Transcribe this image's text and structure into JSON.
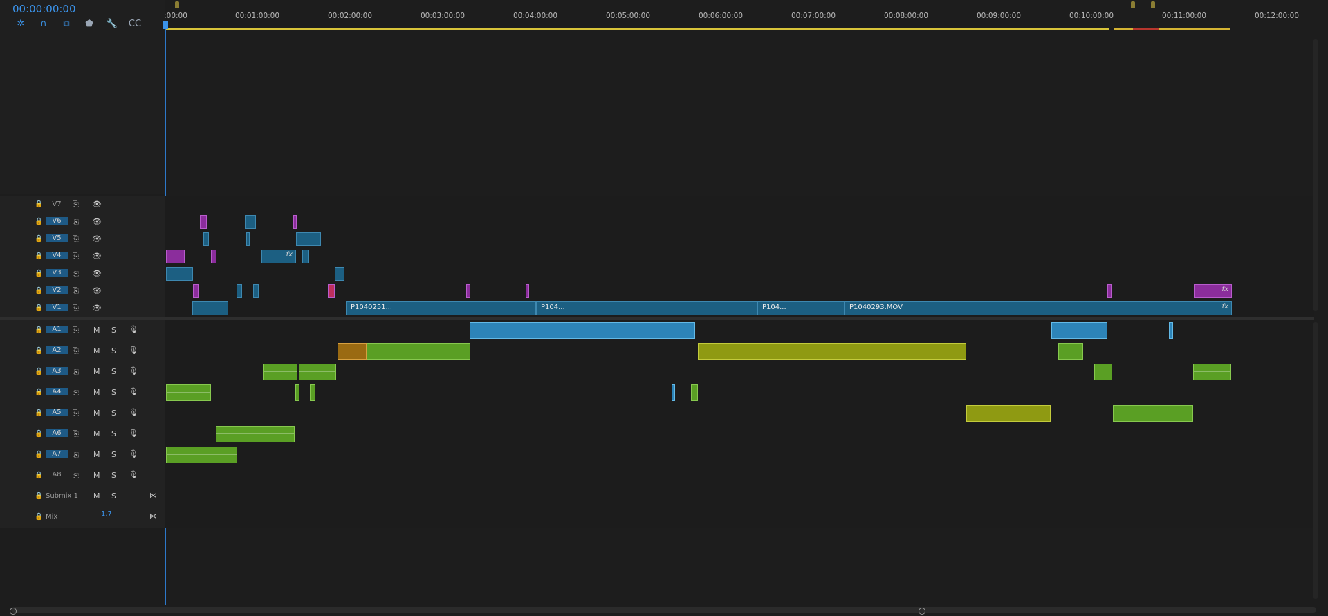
{
  "timecode": "00:00:00:00",
  "toolbar": {
    "icons": [
      "ripple-icon",
      "snap-icon",
      "linked-icon",
      "marker-icon",
      "wrench-icon",
      "captions-icon"
    ]
  },
  "ruler": {
    "labels": [
      ":00:00",
      "00:01:00:00",
      "00:02:00:00",
      "00:03:00:00",
      "00:04:00:00",
      "00:05:00:00",
      "00:06:00:00",
      "00:07:00:00",
      "00:08:00:00",
      "00:09:00:00",
      "00:10:00:00",
      "00:11:00:00",
      "00:12:00:00"
    ]
  },
  "video_tracks": [
    {
      "name": "V7",
      "active": false
    },
    {
      "name": "V6",
      "active": true
    },
    {
      "name": "V5",
      "active": true
    },
    {
      "name": "V4",
      "active": true
    },
    {
      "name": "V3",
      "active": true
    },
    {
      "name": "V2",
      "active": true
    },
    {
      "name": "V1",
      "active": true
    }
  ],
  "audio_tracks": [
    {
      "name": "A1",
      "active": true
    },
    {
      "name": "A2",
      "active": true
    },
    {
      "name": "A3",
      "active": true
    },
    {
      "name": "A4",
      "active": true
    },
    {
      "name": "A5",
      "active": true
    },
    {
      "name": "A6",
      "active": true
    },
    {
      "name": "A7",
      "active": true
    },
    {
      "name": "A8",
      "active": false
    }
  ],
  "submix": {
    "name": "Submix 1"
  },
  "mix": {
    "name": "Mix",
    "value": "1.7"
  },
  "clip_labels": [
    "P1040251...",
    "P104...",
    "P104...",
    "P1040293.MOV"
  ],
  "buttons": {
    "m": "M",
    "s": "S"
  },
  "fx_label": "fx"
}
